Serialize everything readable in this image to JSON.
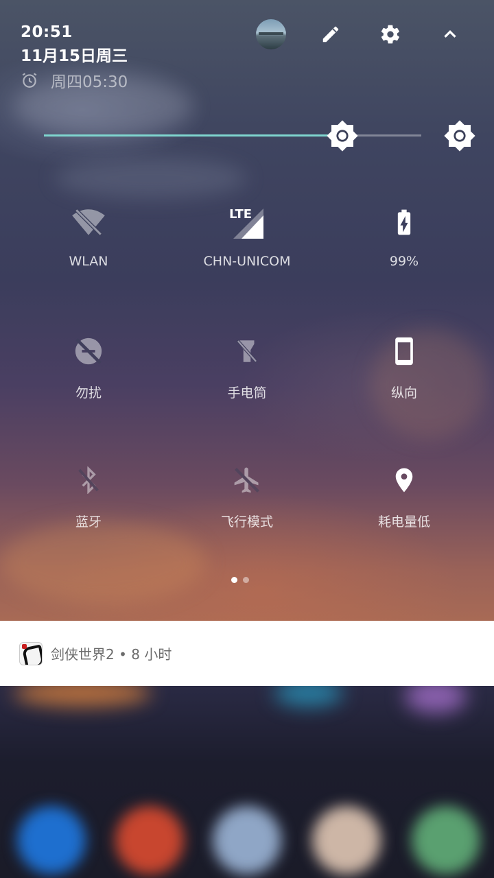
{
  "status": {
    "time": "20:51",
    "date": "11月15日周三",
    "alarm": "周四05:30"
  },
  "header_icons": [
    "avatar",
    "edit-icon",
    "settings-icon",
    "collapse-icon"
  ],
  "brightness": {
    "level": 0.79,
    "accent": "#7fd6cf"
  },
  "tiles": [
    {
      "label": "WLAN",
      "icon": "wifi-off-icon",
      "active": false
    },
    {
      "label": "CHN-UNICOM",
      "icon": "lte-signal-icon",
      "active": true
    },
    {
      "label": "99%",
      "icon": "battery-charging-icon",
      "active": true
    },
    {
      "label": "勿扰",
      "icon": "do-not-disturb-icon",
      "active": false
    },
    {
      "label": "手电筒",
      "icon": "flashlight-off-icon",
      "active": false
    },
    {
      "label": "纵向",
      "icon": "portrait-rotation-icon",
      "active": true
    },
    {
      "label": "蓝牙",
      "icon": "bluetooth-off-icon",
      "active": false
    },
    {
      "label": "飞行模式",
      "icon": "airplane-icon",
      "active": false
    },
    {
      "label": "耗电量低",
      "icon": "location-icon",
      "active": true
    }
  ],
  "page_indicator": {
    "count": 2,
    "current": 1
  },
  "notification": {
    "text": "剑侠世界2 • 8 小时"
  }
}
